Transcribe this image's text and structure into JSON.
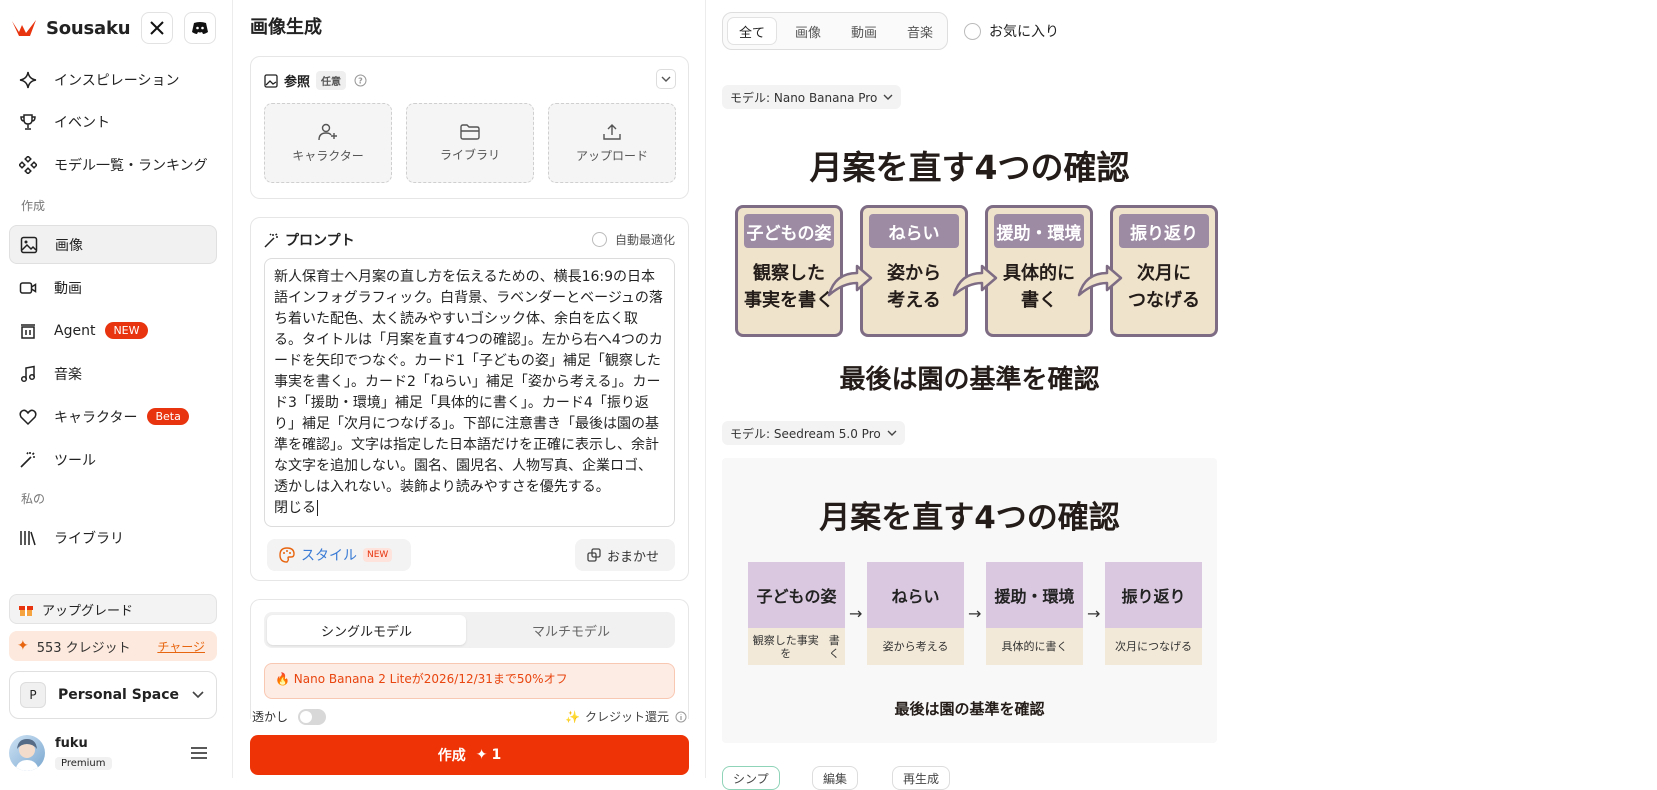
{
  "sidebar": {
    "brand": "Sousaku",
    "nav": [
      {
        "label": "インスピレーション",
        "icon": "sparkle-icon"
      },
      {
        "label": "イベント",
        "icon": "trophy-icon"
      },
      {
        "label": "モデル一覧・ランキング",
        "icon": "models-icon"
      }
    ],
    "section_create": "作成",
    "create_items": [
      {
        "label": "画像",
        "icon": "image-icon"
      },
      {
        "label": "動画",
        "icon": "video-icon"
      },
      {
        "label": "Agent",
        "icon": "agent-icon",
        "badge": "NEW"
      },
      {
        "label": "音楽",
        "icon": "music-icon"
      },
      {
        "label": "キャラクター",
        "icon": "heart-icon",
        "badge": "Beta"
      },
      {
        "label": "ツール",
        "icon": "wand-icon"
      }
    ],
    "section_mine": "私の",
    "mine_items": [
      {
        "label": "ライブラリ",
        "icon": "library-icon"
      }
    ],
    "upgrade": "アップグレード",
    "credits": "553 クレジット",
    "charge": "チャージ",
    "space": {
      "initial": "P",
      "name": "Personal Space"
    },
    "user": {
      "name": "fuku",
      "plan": "Premium"
    }
  },
  "generator": {
    "title": "画像生成",
    "reference": {
      "label": "参照",
      "optional": "任意",
      "boxes": [
        "キャラクター",
        "ライブラリ",
        "アップロード"
      ]
    },
    "prompt": {
      "label": "プロンプト",
      "auto_optimize": "自動最適化",
      "text": "新人保育士へ月案の直し方を伝えるための、横長16:9の日本語インフォグラフィック。白背景、ラベンダーとベージュの落ち着いた配色、太く読みやすいゴシック体、余白を広く取る。タイトルは「月案を直す4つの確認」。左から右へ4つのカードを矢印でつなぐ。カード1「子どもの姿」補足「観察した事実を書く」。カード2「ねらい」補足「姿から考える」。カード3「援助・環境」補足「具体的に書く」。カード4「振り返り」補足「次月につなげる」。下部に注意書き「最後は園の基準を確認」。文字は指定した日本語だけを正確に表示し、余計な文字を追加しない。園名、園児名、人物写真、企業ロゴ、透かしは入れない。装飾より読みやすさを優先する。",
      "close": "閉じる",
      "style_button": "スタイル",
      "style_badge": "NEW",
      "omakase": "おまかせ"
    },
    "models": {
      "single": "シングルモデル",
      "multi": "マルチモデル",
      "promo": "Nano Banana 2 Liteが2026/12/31まで50%オフ"
    },
    "watermark": "透かし",
    "credit_return": "クレジット還元",
    "create_button": "作成",
    "create_cost": "1"
  },
  "gallery": {
    "tabs": [
      "全て",
      "画像",
      "動画",
      "音楽"
    ],
    "favorites": "お気に入り",
    "results": [
      {
        "model": "モデル: Nano Banana Pro",
        "title": "月案を直す4つの確認",
        "cards": [
          {
            "head": "子どもの姿",
            "body": [
              "観察した",
              "事実を書く"
            ]
          },
          {
            "head": "ねらい",
            "body": [
              "姿から",
              "考える"
            ]
          },
          {
            "head": "援助・環境",
            "body": [
              "具体的に",
              "書く"
            ]
          },
          {
            "head": "振り返り",
            "body": [
              "次月に",
              "つなげる"
            ]
          }
        ],
        "footer": "最後は園の基準を確認"
      },
      {
        "model": "モデル: Seedream 5.0 Pro",
        "title": "月案を直す4つの確認",
        "cards": [
          {
            "head": "子どもの姿",
            "body": [
              "観察した事実を",
              "書く"
            ]
          },
          {
            "head": "ねらい",
            "body": [
              "姿から考える"
            ]
          },
          {
            "head": "援助・環境",
            "body": [
              "具体的に書く"
            ]
          },
          {
            "head": "振り返り",
            "body": [
              "次月につなげる"
            ]
          }
        ],
        "footer": "最後は園の基準を確認"
      }
    ],
    "bottom_tabs": [
      "シンプ",
      "編集",
      "再生成"
    ]
  },
  "colors": {
    "accent": "#ee3306",
    "lavender": "#9d8ba4",
    "beige": "#efe3cc"
  }
}
